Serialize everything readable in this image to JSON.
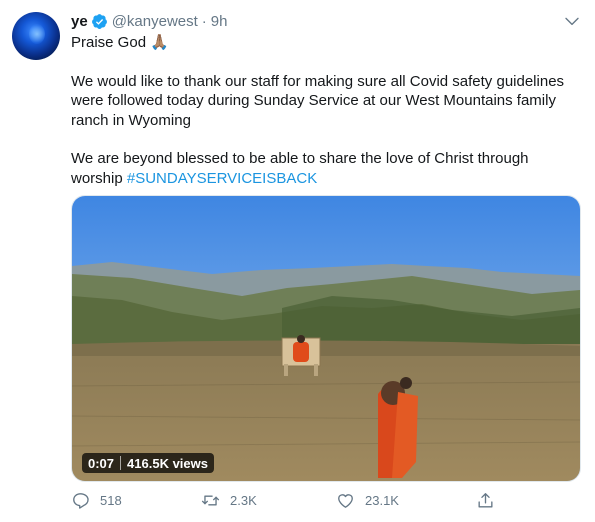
{
  "tweet": {
    "display_name": "ye",
    "handle": "@kanyewest",
    "separator": "·",
    "time": "9h",
    "lines": [
      "Praise God",
      "We would like to thank our staff for making sure all Covid safety guidelines were followed today during Sunday Service at our West Mountains family ranch in Wyoming",
      "We are beyond blessed to be able to share the love of Christ through worship"
    ],
    "emoji": "🙏🏽",
    "hashtag": "#SUNDAYSERVICEISBACK",
    "video": {
      "duration": "0:07",
      "views": "416.5K views"
    },
    "actions": {
      "replies": "518",
      "retweets": "2.3K",
      "likes": "23.1K"
    }
  },
  "icons": {
    "verified": "verified-badge-icon",
    "caret": "chevron-down-icon",
    "reply": "reply-icon",
    "retweet": "retweet-icon",
    "like": "heart-icon",
    "share": "share-icon"
  },
  "colors": {
    "accent": "#1b95e0",
    "text": "#14171a",
    "secondary": "#657786"
  }
}
